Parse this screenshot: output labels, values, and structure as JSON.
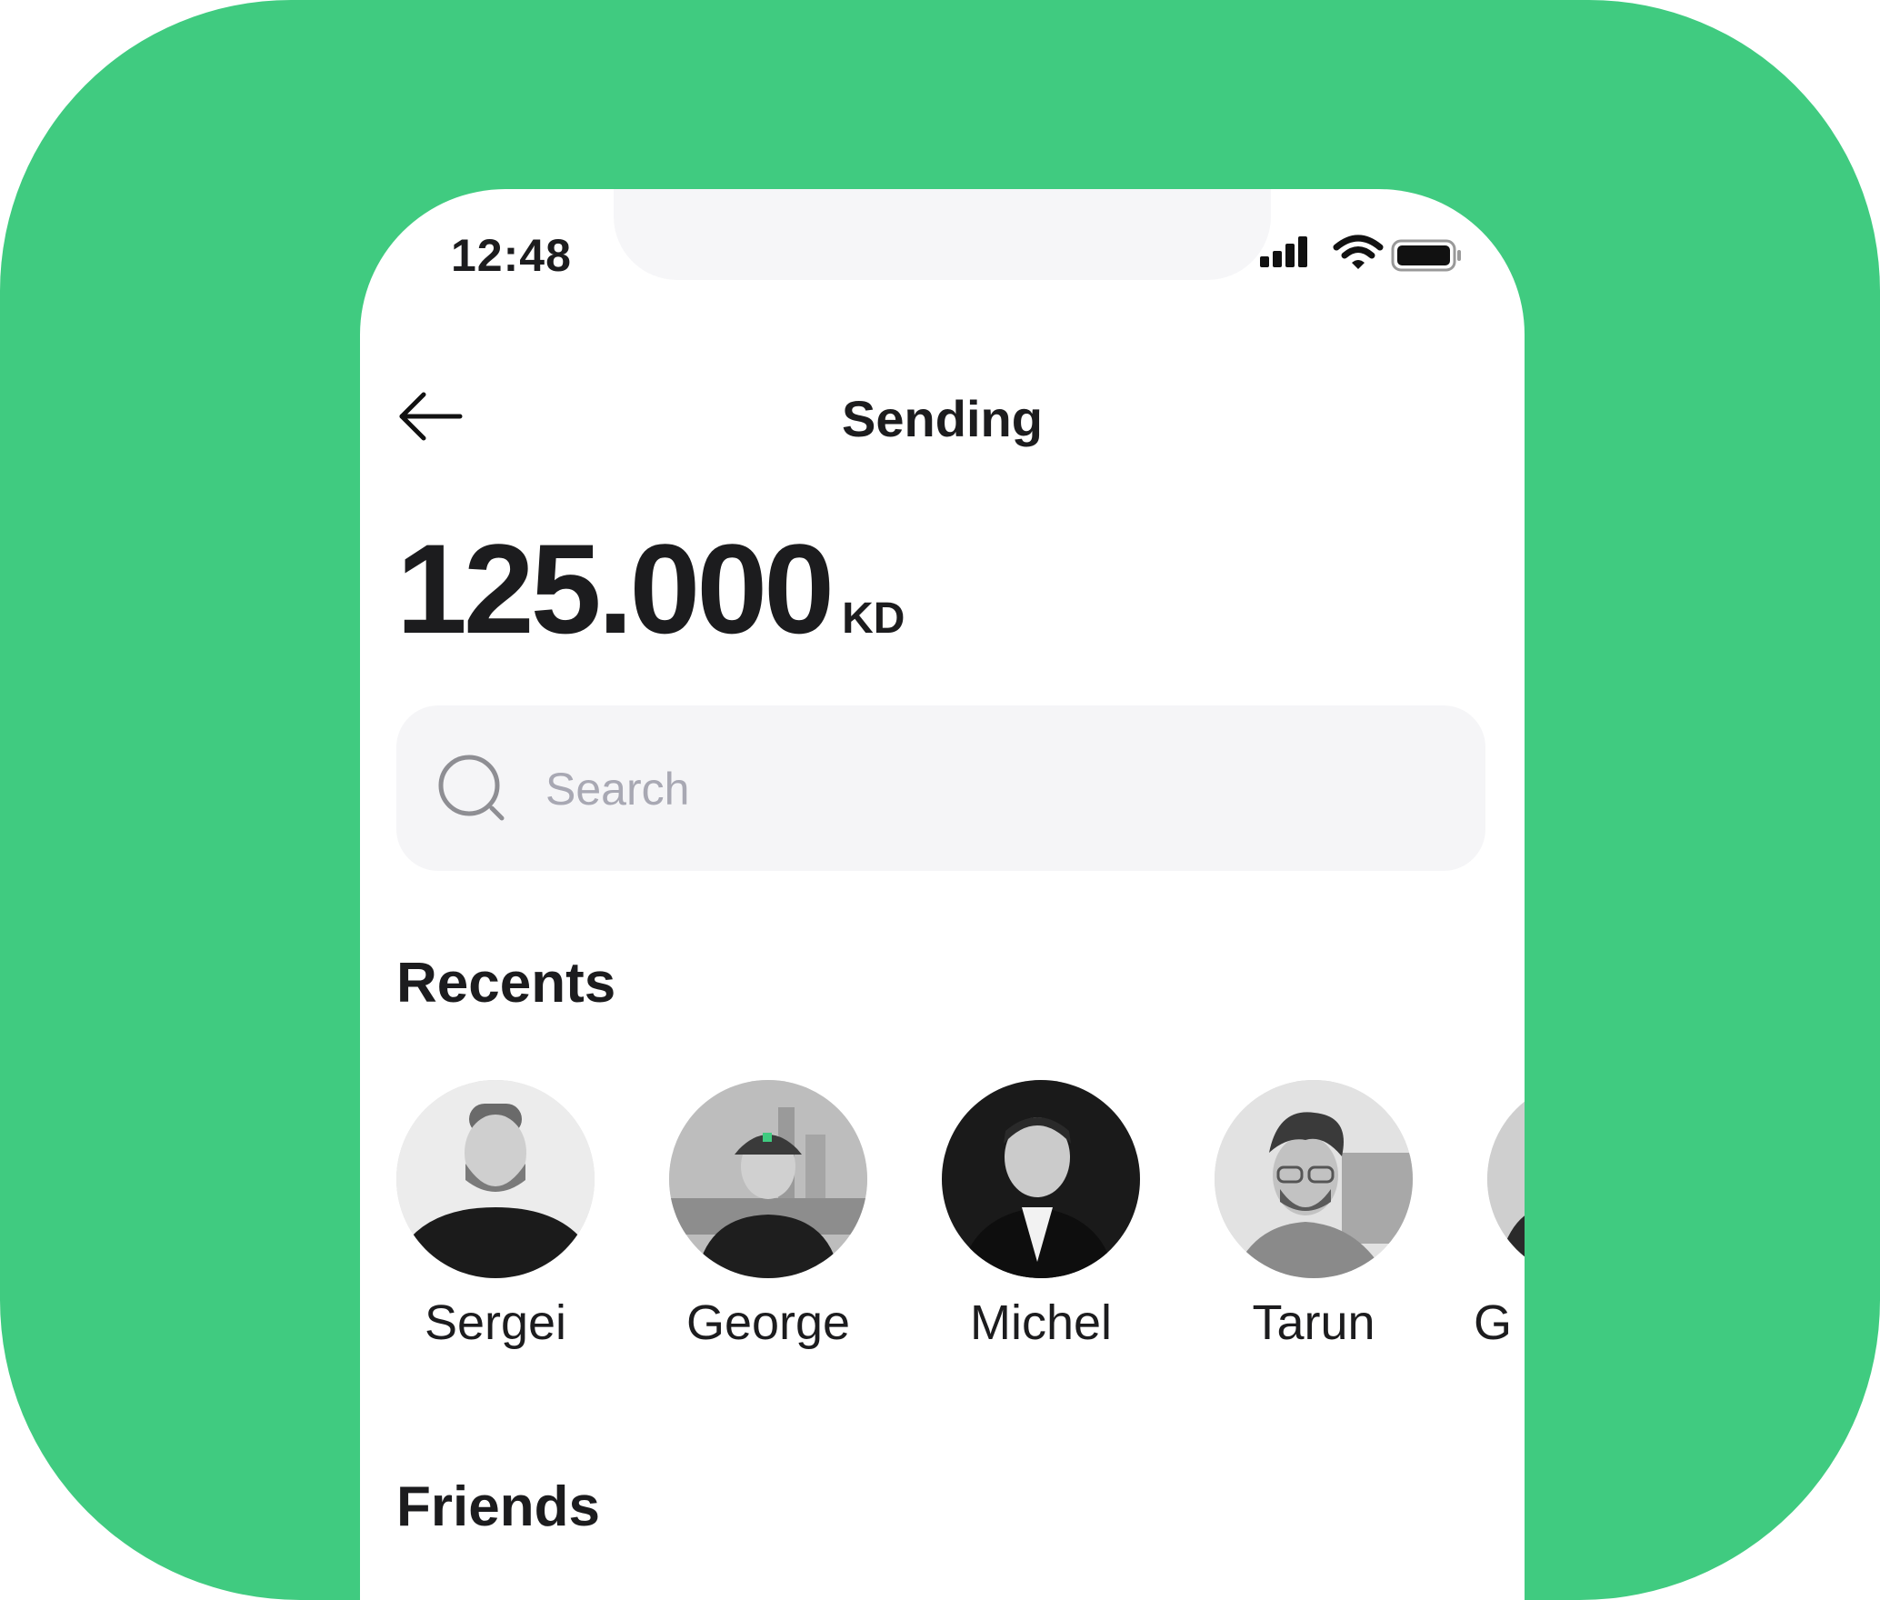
{
  "status": {
    "time": "12:48"
  },
  "header": {
    "title": "Sending"
  },
  "amount": {
    "value": "125.000",
    "currency": "KD"
  },
  "search": {
    "placeholder": "Search"
  },
  "sections": {
    "recents": "Recents",
    "friends": "Friends"
  },
  "recents": [
    {
      "name": "Sergei"
    },
    {
      "name": "George"
    },
    {
      "name": "Michel"
    },
    {
      "name": "Tarun"
    },
    {
      "name": "G"
    }
  ],
  "colors": {
    "accent": "#40CB80",
    "text": "#1c1c1e",
    "placeholder": "#A8A8B3",
    "search_bg": "#F5F5F7"
  }
}
